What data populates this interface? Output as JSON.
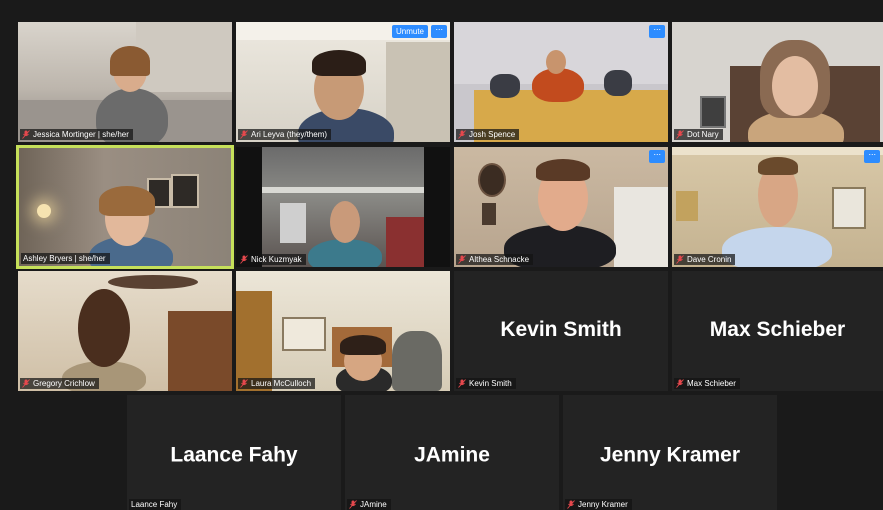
{
  "controls": {
    "unmute_label": "Unmute",
    "more_label": "···"
  },
  "participants": [
    {
      "name": "Jessica Mortinger | she/her"
    },
    {
      "name": "Ari Leyva (they/them)"
    },
    {
      "name": "Josh Spence"
    },
    {
      "name": "Dot Nary"
    },
    {
      "name": "Ashley Bryers | she/her"
    },
    {
      "name": "Nick Kuzmyak"
    },
    {
      "name": "Althea Schnacke"
    },
    {
      "name": "Dave Cronin"
    },
    {
      "name": "Gregory Crichlow"
    },
    {
      "name": "Laura McCulloch"
    },
    {
      "name": "Kevin Smith",
      "display": "Kevin Smith"
    },
    {
      "name": "Max Schieber",
      "display": "Max Schieber"
    },
    {
      "name": "Laance Fahy",
      "display": "Laance Fahy"
    },
    {
      "name": "JAmine",
      "display": "JAmine"
    },
    {
      "name": "Jenny Kramer",
      "display": "Jenny Kramer"
    }
  ]
}
